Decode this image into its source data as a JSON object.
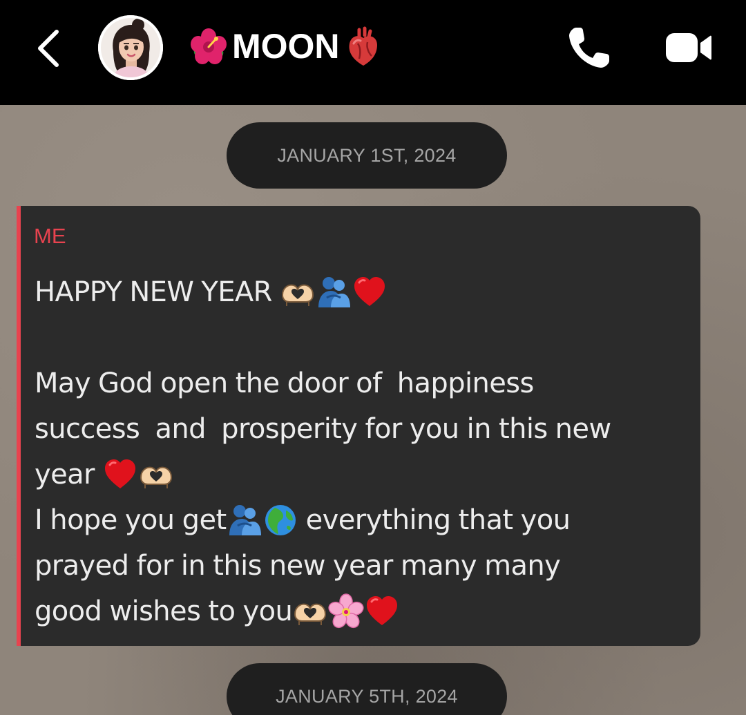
{
  "header": {
    "back_icon": "chevron-left-icon",
    "avatar_icon": "avatar-memoji",
    "contact_name": "MOON",
    "name_prefix_emoji": "hibiscus",
    "name_suffix_emoji": "anatomical-heart",
    "call_icon": "phone-icon",
    "video_icon": "video-camera-icon"
  },
  "chat": {
    "date_separators": [
      "JANUARY 1ST, 2024",
      "JANUARY 5TH, 2024"
    ],
    "message": {
      "sender": "ME",
      "lines": [
        "HAPPY NEW YEAR",
        "",
        "May God open the door of  happiness",
        "success  and  prosperity for you in this new",
        "year",
        "I hope you get",
        " everything that you",
        "prayed for in this new year many many",
        "good wishes to you"
      ],
      "emojis": {
        "line1": [
          "heart-hands",
          "people-hugging",
          "red-heart"
        ],
        "line5": [
          "red-heart",
          "heart-hands"
        ],
        "line6": [
          "people-hugging",
          "globe-africa"
        ],
        "line9": [
          "heart-hands",
          "cherry-blossom",
          "red-heart"
        ]
      }
    }
  },
  "colors": {
    "header_bg": "#000000",
    "bubble_bg": "#2b2b2b",
    "accent": "#e8434f",
    "date_pill_bg": "#1f1f1f",
    "date_text": "#a5a5a5",
    "message_text": "#ededed"
  }
}
